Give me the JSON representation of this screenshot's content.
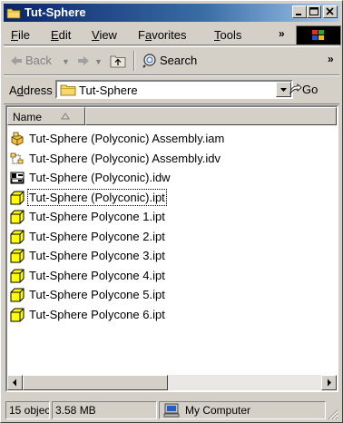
{
  "window": {
    "title": "Tut-Sphere"
  },
  "menubar": {
    "items": [
      {
        "label": "File",
        "accel": "F",
        "rest": "ile"
      },
      {
        "label": "Edit",
        "accel": "E",
        "rest": "dit"
      },
      {
        "label": "View",
        "accel": "V",
        "rest": "iew"
      },
      {
        "label": "Favorites",
        "pre": "F",
        "accel": "a",
        "rest": "vorites"
      },
      {
        "label": "Tools",
        "accel": "T",
        "rest": "ools"
      }
    ],
    "overflow": "»"
  },
  "toolbar": {
    "back_label": "Back",
    "search_label": "Search",
    "overflow": "»"
  },
  "address": {
    "label_pre": "A",
    "label_accel": "d",
    "label_rest": "dress",
    "value": "Tut-Sphere",
    "go_label": "Go"
  },
  "list": {
    "column_name": "Name",
    "files": [
      {
        "name": "Tut-Sphere (Polyconic) Assembly.iam",
        "icon": "assembly-icon"
      },
      {
        "name": "Tut-Sphere (Polyconic) Assembly.idv",
        "icon": "presentation-icon"
      },
      {
        "name": "Tut-Sphere (Polyconic).idw",
        "icon": "drawing-icon"
      },
      {
        "name": "Tut-Sphere (Polyconic).ipt",
        "icon": "part-icon"
      },
      {
        "name": "Tut-Sphere Polycone 1.ipt",
        "icon": "part-icon"
      },
      {
        "name": "Tut-Sphere Polycone 2.ipt",
        "icon": "part-icon"
      },
      {
        "name": "Tut-Sphere Polycone 3.ipt",
        "icon": "part-icon"
      },
      {
        "name": "Tut-Sphere Polycone 4.ipt",
        "icon": "part-icon"
      },
      {
        "name": "Tut-Sphere Polycone 5.ipt",
        "icon": "part-icon"
      },
      {
        "name": "Tut-Sphere Polycone 6.ipt",
        "icon": "part-icon"
      }
    ]
  },
  "status": {
    "count": "15 objec",
    "size": "3.58 MB",
    "zone": "My Computer"
  },
  "colors": {
    "title_start": "#0a246a",
    "title_end": "#a6caf0",
    "face": "#d4d0c8",
    "folder": "#f5d76e",
    "part": "#ffff00"
  }
}
